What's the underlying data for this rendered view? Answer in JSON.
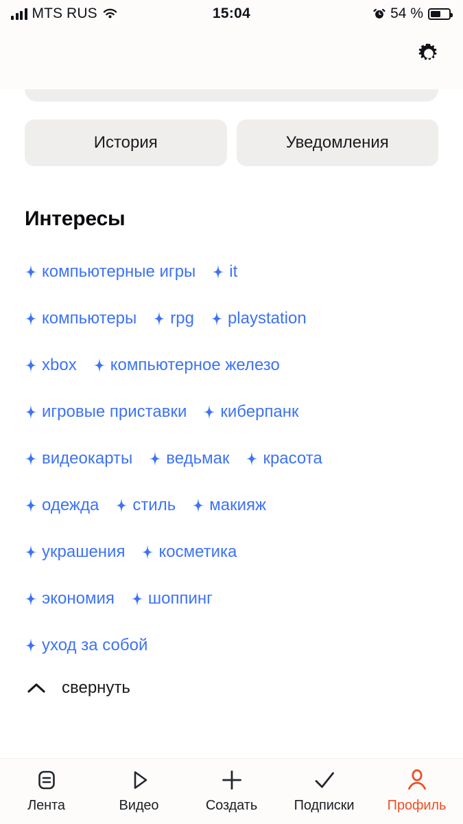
{
  "status_bar": {
    "carrier": "MTS RUS",
    "time": "15:04",
    "battery_percent": "54 %",
    "icons": [
      "signal-bars-icon",
      "wifi-icon",
      "alarm-clock-icon",
      "battery-icon"
    ]
  },
  "header": {
    "settings_icon": "gear-icon"
  },
  "buttons": {
    "history": "История",
    "notifications": "Уведомления"
  },
  "interests": {
    "title": "Интересы",
    "tag_icon": "sparkle-icon",
    "rows": [
      [
        "компьютерные игры",
        "it"
      ],
      [
        "компьютеры",
        "rpg",
        "playstation"
      ],
      [
        "xbox",
        "компьютерное железо"
      ],
      [
        "игровые приставки",
        "киберпанк"
      ],
      [
        "видеокарты",
        "ведьмак",
        "красота"
      ],
      [
        "одежда",
        "стиль",
        "макияж"
      ],
      [
        "украшения",
        "косметика"
      ],
      [
        "экономия",
        "шоппинг"
      ],
      [
        "уход за собой"
      ]
    ],
    "collapse_label": "свернуть",
    "collapse_icon": "chevron-up-icon"
  },
  "tabbar": {
    "items": [
      {
        "label": "Лента",
        "icon": "feed-icon",
        "active": false
      },
      {
        "label": "Видео",
        "icon": "play-triangle-icon",
        "active": false
      },
      {
        "label": "Создать",
        "icon": "plus-icon",
        "active": false
      },
      {
        "label": "Подписки",
        "icon": "check-icon",
        "active": false
      },
      {
        "label": "Профиль",
        "icon": "person-icon",
        "active": true
      }
    ]
  },
  "colors": {
    "tag_blue": "#3d73f5",
    "accent_orange": "#ef4e23",
    "chip_gray": "#f0eeec",
    "surface": "#fdfcfb",
    "text": "#111318"
  }
}
